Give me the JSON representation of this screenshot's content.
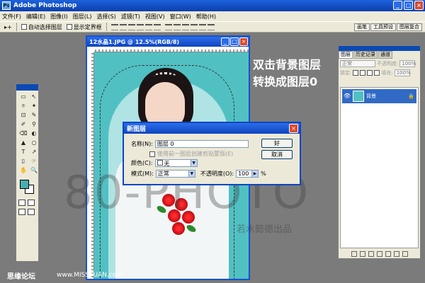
{
  "app": {
    "title": "Adobe Photoshop",
    "logo": "Ps"
  },
  "window_buttons": [
    "_",
    "□",
    "×"
  ],
  "menu": [
    "文件(F)",
    "编辑(E)",
    "图像(I)",
    "图层(L)",
    "选择(S)",
    "滤镜(T)",
    "视图(V)",
    "窗口(W)",
    "帮助(H)"
  ],
  "options": {
    "tool_glyph": "▸+",
    "auto_select_layer": "自动选择图层",
    "show_bounding_box": "显示定界框",
    "palette_tabs": [
      "画笔",
      "工具预设",
      "图层复合"
    ]
  },
  "document": {
    "title": "12水晶1.JPG @ 12.5%(RGB/8)"
  },
  "overlay": {
    "line1": "双击背景图层",
    "line2": "转换成图层0"
  },
  "watermark": {
    "big": "80-PHOTO",
    "sub": "若水懿德出品"
  },
  "footer": {
    "left": "思缘论坛",
    "right": "www.MISSYUAN.com"
  },
  "dialog": {
    "title": "新图层",
    "name_label": "名称(N):",
    "name_value": "图层 0",
    "group_checkbox": "使用前一图层创建剪贴蒙版(E)",
    "color_label": "颜色(C):",
    "color_value": "无",
    "mode_label": "模式(M):",
    "mode_value": "正常",
    "opacity_label": "不透明度(O):",
    "opacity_value": "100",
    "opacity_unit": "%",
    "ok": "好",
    "cancel": "取消"
  },
  "layers_panel": {
    "tabs": [
      "图层",
      "历史记录",
      "通道"
    ],
    "blend_mode": "正常",
    "opacity_label": "不透明度:",
    "opacity_value": "100%",
    "lock_label": "锁定:",
    "fill_label": "填充:",
    "fill_value": "100%",
    "layer_name": "背景",
    "lock_glyph": "🔒"
  },
  "tools": [
    "▭",
    "↖",
    "⌾",
    "✦",
    "⊡",
    "✎",
    "✐",
    "⚲",
    "⌫",
    "◐",
    "▲",
    "○",
    "T",
    "↗",
    "▯",
    "☞",
    "✋",
    "🔍"
  ],
  "colors": {
    "accent": "#0e44c0",
    "foreground": "#49aeb1",
    "canvas": "#51c0c2"
  }
}
